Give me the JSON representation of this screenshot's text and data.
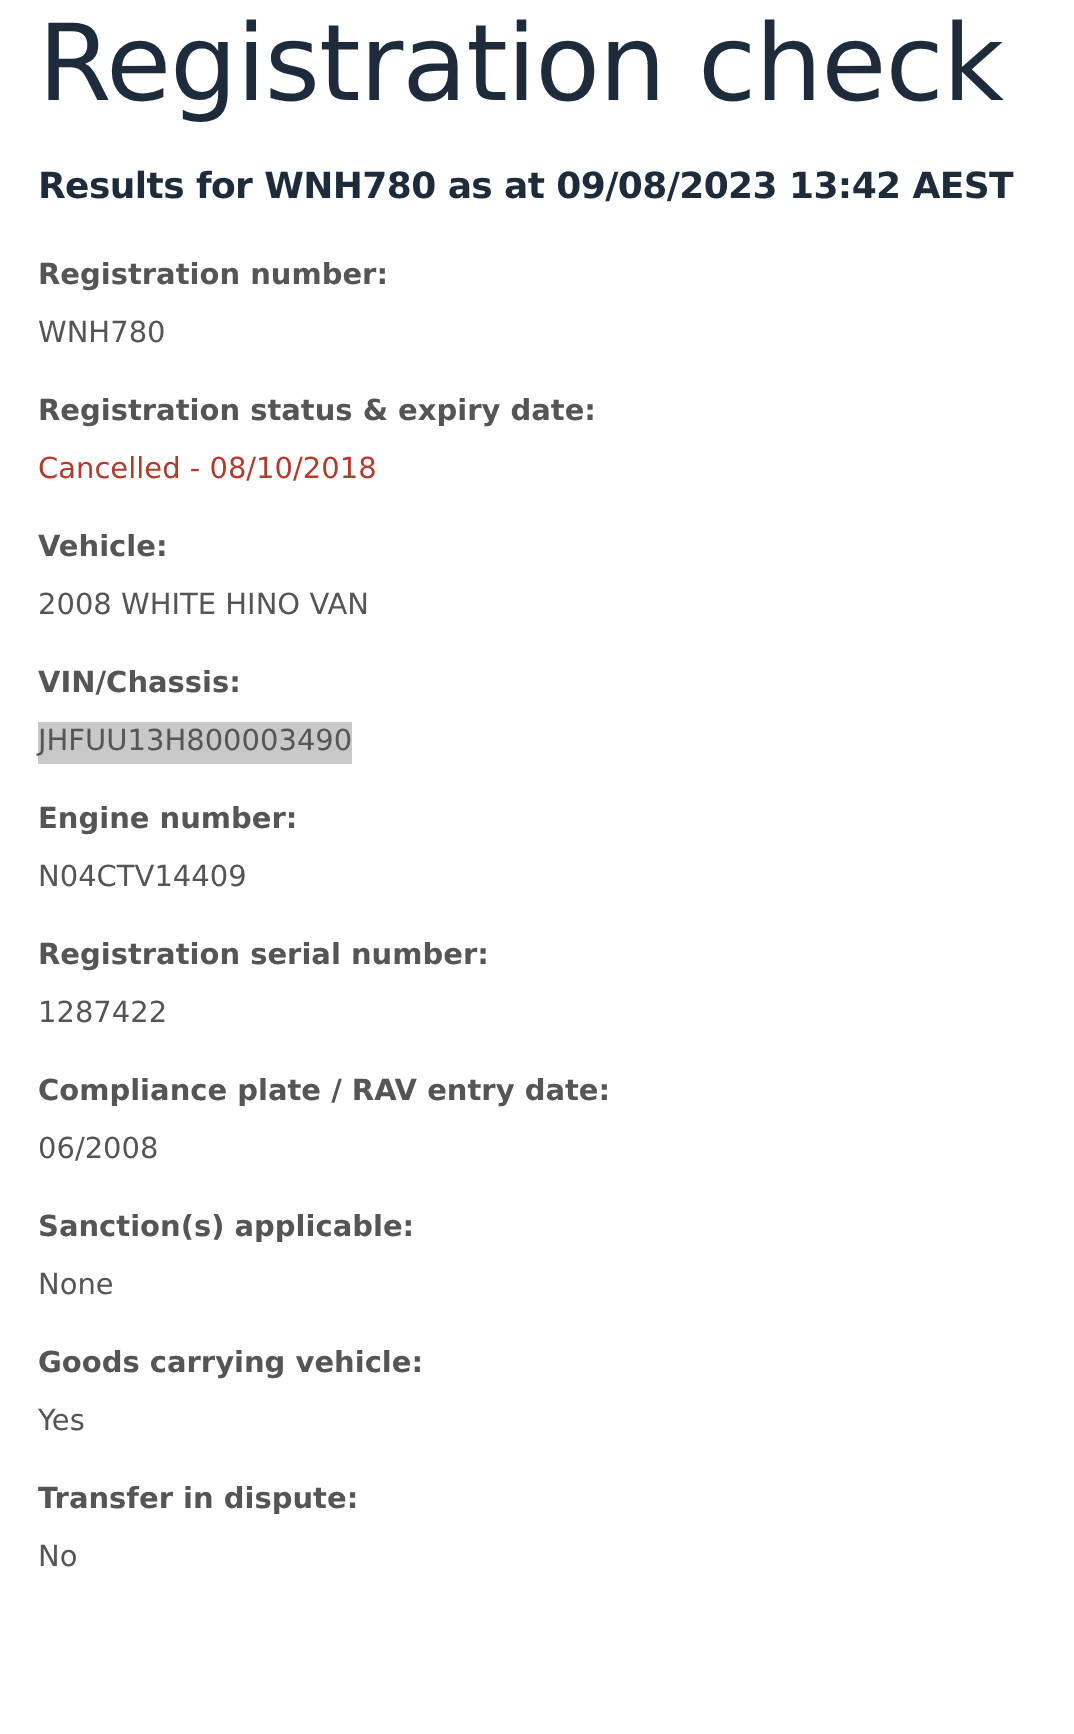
{
  "title": "Registration check",
  "subtitle": "Results for WNH780 as at 09/08/2023 13:42 AEST",
  "fields": [
    {
      "label": "Registration number:",
      "value": "WNH780",
      "kind": "plain",
      "highlighted": false
    },
    {
      "label": "Registration status & expiry date:",
      "value": "Cancelled - 08/10/2018",
      "kind": "alert",
      "highlighted": false
    },
    {
      "label": "Vehicle:",
      "value": "2008 WHITE HINO VAN",
      "kind": "plain",
      "highlighted": false
    },
    {
      "label": "VIN/Chassis:",
      "value": "JHFUU13H800003490",
      "kind": "plain",
      "highlighted": true
    },
    {
      "label": "Engine number:",
      "value": "N04CTV14409",
      "kind": "plain",
      "highlighted": false
    },
    {
      "label": "Registration serial number:",
      "value": "1287422",
      "kind": "plain",
      "highlighted": false
    },
    {
      "label": "Compliance plate / RAV entry date:",
      "value": "06/2008",
      "kind": "plain",
      "highlighted": false
    },
    {
      "label": "Sanction(s) applicable:",
      "value": "None",
      "kind": "plain",
      "highlighted": false
    },
    {
      "label": "Goods carrying vehicle:",
      "value": "Yes",
      "kind": "plain",
      "highlighted": false
    },
    {
      "label": "Transfer in dispute:",
      "value": "No",
      "kind": "plain",
      "highlighted": false
    }
  ]
}
